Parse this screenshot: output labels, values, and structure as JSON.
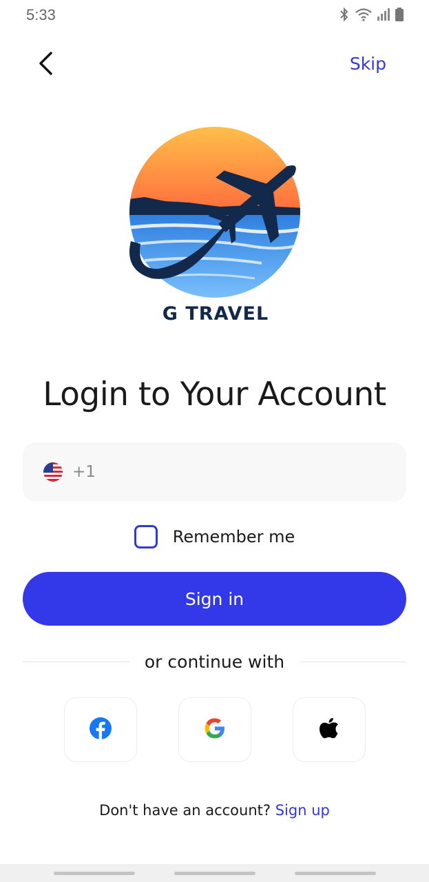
{
  "status_bar": {
    "time": "5:33",
    "icons": [
      "bluetooth-icon",
      "wifi-icon",
      "signal-icon",
      "battery-icon"
    ]
  },
  "header": {
    "back_icon": "chevron-left-icon",
    "skip_label": "Skip"
  },
  "logo": {
    "text": "G TRAVEL"
  },
  "title": "Login to Your Account",
  "phone_field": {
    "flag": "us-flag-icon",
    "dial_code": "+1",
    "value": "",
    "placeholder": ""
  },
  "remember": {
    "label": "Remember me",
    "checked": false
  },
  "signin_label": "Sign in",
  "divider_text": "or continue with",
  "social": [
    "facebook-icon",
    "google-icon",
    "apple-icon"
  ],
  "signup": {
    "prompt": "Don't have an account?",
    "link": "Sign up"
  },
  "colors": {
    "accent": "#3338e8",
    "link": "#3338d8",
    "logo_navy": "#13294b"
  }
}
